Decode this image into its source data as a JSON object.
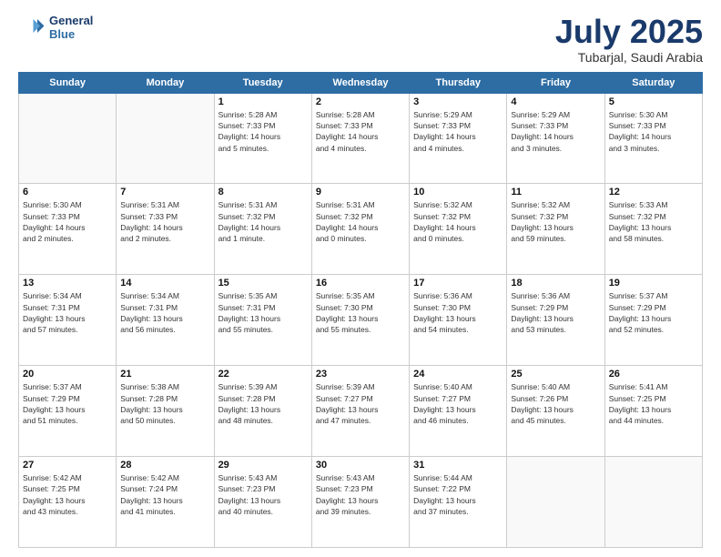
{
  "header": {
    "logo_line1": "General",
    "logo_line2": "Blue",
    "month": "July 2025",
    "location": "Tubarjal, Saudi Arabia"
  },
  "days_of_week": [
    "Sunday",
    "Monday",
    "Tuesday",
    "Wednesday",
    "Thursday",
    "Friday",
    "Saturday"
  ],
  "weeks": [
    [
      {
        "day": "",
        "info": ""
      },
      {
        "day": "",
        "info": ""
      },
      {
        "day": "1",
        "info": "Sunrise: 5:28 AM\nSunset: 7:33 PM\nDaylight: 14 hours\nand 5 minutes."
      },
      {
        "day": "2",
        "info": "Sunrise: 5:28 AM\nSunset: 7:33 PM\nDaylight: 14 hours\nand 4 minutes."
      },
      {
        "day": "3",
        "info": "Sunrise: 5:29 AM\nSunset: 7:33 PM\nDaylight: 14 hours\nand 4 minutes."
      },
      {
        "day": "4",
        "info": "Sunrise: 5:29 AM\nSunset: 7:33 PM\nDaylight: 14 hours\nand 3 minutes."
      },
      {
        "day": "5",
        "info": "Sunrise: 5:30 AM\nSunset: 7:33 PM\nDaylight: 14 hours\nand 3 minutes."
      }
    ],
    [
      {
        "day": "6",
        "info": "Sunrise: 5:30 AM\nSunset: 7:33 PM\nDaylight: 14 hours\nand 2 minutes."
      },
      {
        "day": "7",
        "info": "Sunrise: 5:31 AM\nSunset: 7:33 PM\nDaylight: 14 hours\nand 2 minutes."
      },
      {
        "day": "8",
        "info": "Sunrise: 5:31 AM\nSunset: 7:32 PM\nDaylight: 14 hours\nand 1 minute."
      },
      {
        "day": "9",
        "info": "Sunrise: 5:31 AM\nSunset: 7:32 PM\nDaylight: 14 hours\nand 0 minutes."
      },
      {
        "day": "10",
        "info": "Sunrise: 5:32 AM\nSunset: 7:32 PM\nDaylight: 14 hours\nand 0 minutes."
      },
      {
        "day": "11",
        "info": "Sunrise: 5:32 AM\nSunset: 7:32 PM\nDaylight: 13 hours\nand 59 minutes."
      },
      {
        "day": "12",
        "info": "Sunrise: 5:33 AM\nSunset: 7:32 PM\nDaylight: 13 hours\nand 58 minutes."
      }
    ],
    [
      {
        "day": "13",
        "info": "Sunrise: 5:34 AM\nSunset: 7:31 PM\nDaylight: 13 hours\nand 57 minutes."
      },
      {
        "day": "14",
        "info": "Sunrise: 5:34 AM\nSunset: 7:31 PM\nDaylight: 13 hours\nand 56 minutes."
      },
      {
        "day": "15",
        "info": "Sunrise: 5:35 AM\nSunset: 7:31 PM\nDaylight: 13 hours\nand 55 minutes."
      },
      {
        "day": "16",
        "info": "Sunrise: 5:35 AM\nSunset: 7:30 PM\nDaylight: 13 hours\nand 55 minutes."
      },
      {
        "day": "17",
        "info": "Sunrise: 5:36 AM\nSunset: 7:30 PM\nDaylight: 13 hours\nand 54 minutes."
      },
      {
        "day": "18",
        "info": "Sunrise: 5:36 AM\nSunset: 7:29 PM\nDaylight: 13 hours\nand 53 minutes."
      },
      {
        "day": "19",
        "info": "Sunrise: 5:37 AM\nSunset: 7:29 PM\nDaylight: 13 hours\nand 52 minutes."
      }
    ],
    [
      {
        "day": "20",
        "info": "Sunrise: 5:37 AM\nSunset: 7:29 PM\nDaylight: 13 hours\nand 51 minutes."
      },
      {
        "day": "21",
        "info": "Sunrise: 5:38 AM\nSunset: 7:28 PM\nDaylight: 13 hours\nand 50 minutes."
      },
      {
        "day": "22",
        "info": "Sunrise: 5:39 AM\nSunset: 7:28 PM\nDaylight: 13 hours\nand 48 minutes."
      },
      {
        "day": "23",
        "info": "Sunrise: 5:39 AM\nSunset: 7:27 PM\nDaylight: 13 hours\nand 47 minutes."
      },
      {
        "day": "24",
        "info": "Sunrise: 5:40 AM\nSunset: 7:27 PM\nDaylight: 13 hours\nand 46 minutes."
      },
      {
        "day": "25",
        "info": "Sunrise: 5:40 AM\nSunset: 7:26 PM\nDaylight: 13 hours\nand 45 minutes."
      },
      {
        "day": "26",
        "info": "Sunrise: 5:41 AM\nSunset: 7:25 PM\nDaylight: 13 hours\nand 44 minutes."
      }
    ],
    [
      {
        "day": "27",
        "info": "Sunrise: 5:42 AM\nSunset: 7:25 PM\nDaylight: 13 hours\nand 43 minutes."
      },
      {
        "day": "28",
        "info": "Sunrise: 5:42 AM\nSunset: 7:24 PM\nDaylight: 13 hours\nand 41 minutes."
      },
      {
        "day": "29",
        "info": "Sunrise: 5:43 AM\nSunset: 7:23 PM\nDaylight: 13 hours\nand 40 minutes."
      },
      {
        "day": "30",
        "info": "Sunrise: 5:43 AM\nSunset: 7:23 PM\nDaylight: 13 hours\nand 39 minutes."
      },
      {
        "day": "31",
        "info": "Sunrise: 5:44 AM\nSunset: 7:22 PM\nDaylight: 13 hours\nand 37 minutes."
      },
      {
        "day": "",
        "info": ""
      },
      {
        "day": "",
        "info": ""
      }
    ]
  ]
}
